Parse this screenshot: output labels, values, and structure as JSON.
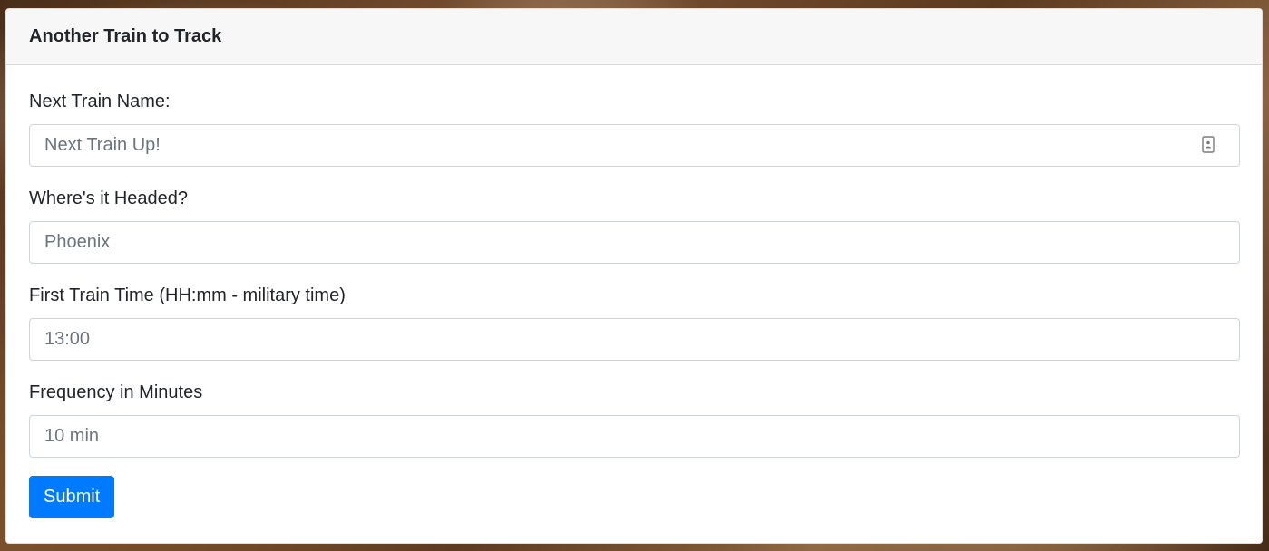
{
  "form": {
    "title": "Another Train to Track",
    "fields": [
      {
        "label": "Next Train Name:",
        "placeholder": "Next Train Up!",
        "value": ""
      },
      {
        "label": "Where's it Headed?",
        "placeholder": "Phoenix",
        "value": ""
      },
      {
        "label": "First Train Time (HH:mm - military time)",
        "placeholder": "13:00",
        "value": ""
      },
      {
        "label": "Frequency in Minutes",
        "placeholder": "10 min",
        "value": ""
      }
    ],
    "submit_label": "Submit",
    "autofill_icon": "contact-card-icon"
  },
  "colors": {
    "primary": "#007bff",
    "header_bg": "#f7f7f7",
    "text": "#212529",
    "placeholder": "#6c757d",
    "border": "#ced4da"
  }
}
